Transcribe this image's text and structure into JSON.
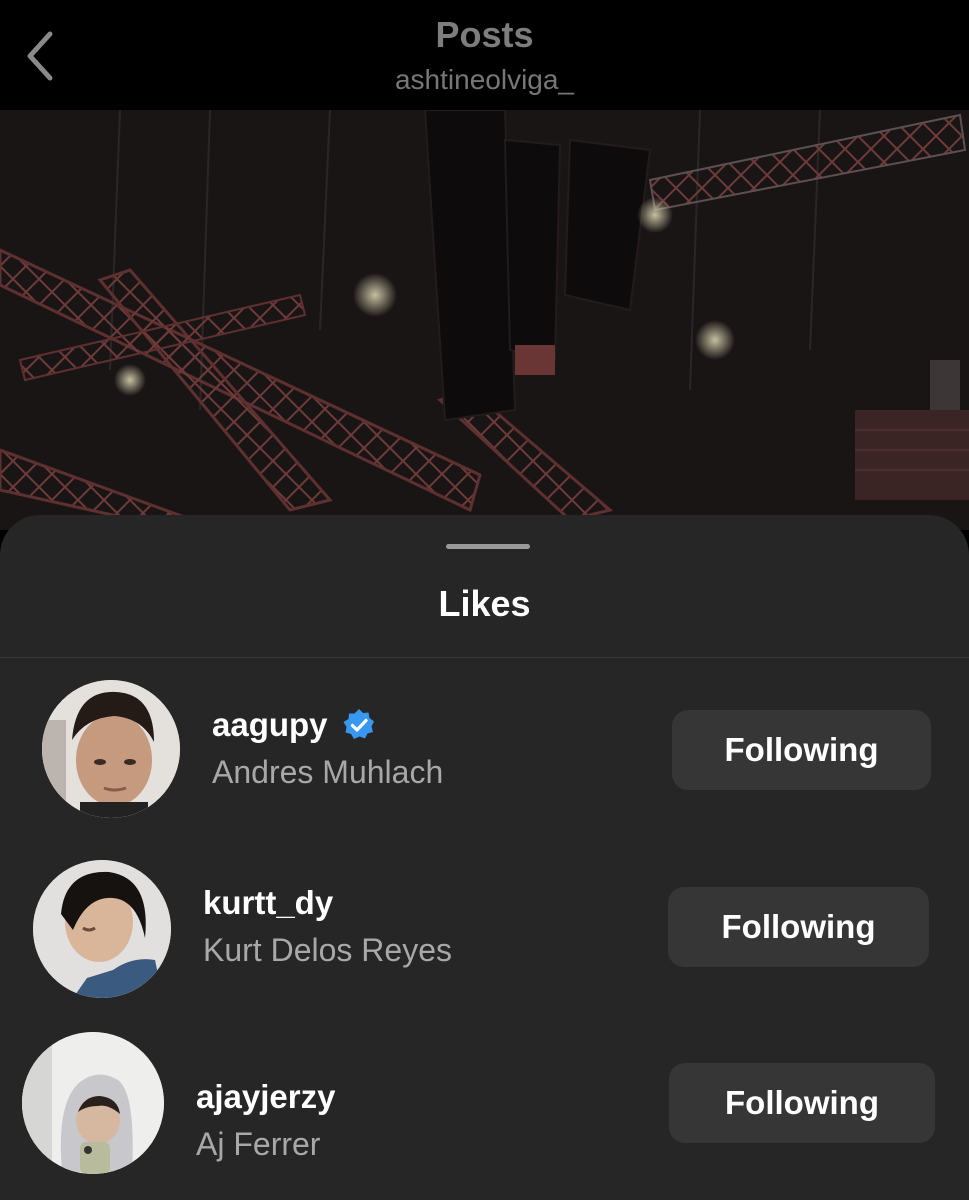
{
  "header": {
    "title": "Posts",
    "subtitle": "ashtineolviga_",
    "back_icon": "chevron-left-icon"
  },
  "sheet": {
    "title": "Likes"
  },
  "likes": [
    {
      "username": "aagupy",
      "full_name": "Andres Muhlach",
      "verified": true,
      "button_label": "Following"
    },
    {
      "username": "kurtt_dy",
      "full_name": "Kurt Delos Reyes",
      "verified": false,
      "button_label": "Following"
    },
    {
      "username": "ajayjerzy",
      "full_name": "Aj Ferrer",
      "verified": false,
      "button_label": "Following"
    }
  ],
  "colors": {
    "sheet_background": "#262626",
    "button_background": "#363636",
    "verified_badge": "#3897f0"
  }
}
